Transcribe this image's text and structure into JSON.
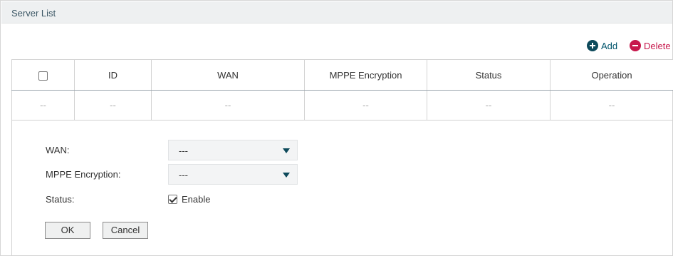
{
  "section": {
    "title": "Server List"
  },
  "toolbar": {
    "add_label": "Add",
    "delete_label": "Delete",
    "add_icon": "plus-circle-icon",
    "delete_icon": "minus-circle-icon"
  },
  "table": {
    "headers": [
      "ID",
      "WAN",
      "MPPE Encryption",
      "Status",
      "Operation"
    ],
    "rows": [
      [
        "--",
        "--",
        "--",
        "--",
        "--",
        "--"
      ]
    ]
  },
  "form": {
    "wan_label": "WAN:",
    "wan_value": "---",
    "mppe_label": "MPPE Encryption:",
    "mppe_value": "---",
    "status_label": "Status:",
    "enable_label": "Enable",
    "enable_checked": true,
    "ok_label": "OK",
    "cancel_label": "Cancel"
  },
  "colors": {
    "accent": "#0d4a5b",
    "danger": "#c7184c",
    "header_bg": "#eef0f1"
  }
}
